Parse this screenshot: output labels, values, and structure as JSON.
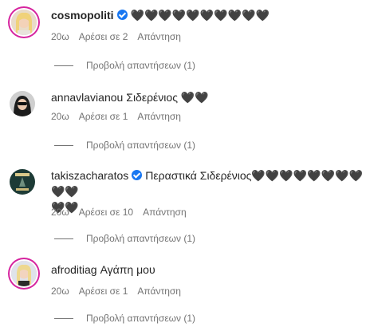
{
  "comments": [
    {
      "user": "cosmopoliti",
      "verified": true,
      "text": "🖤🖤🖤🖤🖤🖤🖤🖤🖤🖤",
      "time": "20ω",
      "likes": "Αρέσει σε 2",
      "reply": "Απάντηση",
      "view_replies": "Προβολή απαντήσεων (1)",
      "avatar_icon": "user-avatar-blonde"
    },
    {
      "user": "annavlavianou",
      "verified": false,
      "text": "Σιδερένιος 🖤🖤",
      "time": "20ω",
      "likes": "Αρέσει σε 1",
      "reply": "Απάντηση",
      "view_replies": "Προβολή απαντήσεων (1)",
      "avatar_icon": "user-avatar-dark"
    },
    {
      "user": "takiszacharatos",
      "verified": true,
      "text": "Περαστικά Σιδερένιος🖤🖤🖤🖤🖤🖤🖤🖤🖤🖤",
      "text_cont": "🖤🖤",
      "time": "20ω",
      "likes": "Αρέσει σε 10",
      "reply": "Απάντηση",
      "view_replies": "Προβολή απαντήσεων (1)",
      "avatar_icon": "user-avatar-poster"
    },
    {
      "user": "afroditiag",
      "verified": false,
      "text": "Αγάπη μου",
      "time": "20ω",
      "likes": "Αρέσει σε 1",
      "reply": "Απάντηση",
      "view_replies": "Προβολή απαντήσεων (1)",
      "avatar_icon": "user-avatar-blonde"
    }
  ],
  "colors": {
    "text": "#262626",
    "secondary": "#737373",
    "verified": "#1877f2",
    "story_ring": "#d6249f"
  }
}
